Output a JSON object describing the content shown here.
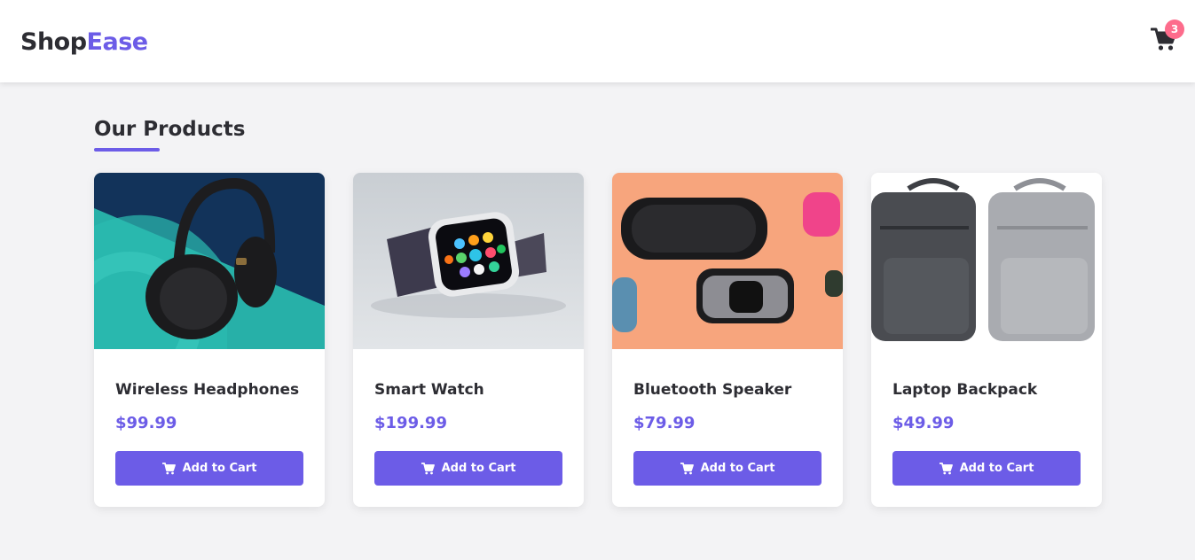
{
  "brand": {
    "part1": "Shop",
    "part2": "Ease"
  },
  "cart": {
    "count": "3",
    "icon": "cart-icon"
  },
  "section": {
    "title": "Our Products"
  },
  "products": [
    {
      "name": "Wireless Headphones",
      "price": "$99.99",
      "button": "Add to Cart",
      "image": "headphones-image"
    },
    {
      "name": "Smart Watch",
      "price": "$199.99",
      "button": "Add to Cart",
      "image": "smartwatch-image"
    },
    {
      "name": "Bluetooth Speaker",
      "price": "$79.99",
      "button": "Add to Cart",
      "image": "speaker-image"
    },
    {
      "name": "Laptop Backpack",
      "price": "$49.99",
      "button": "Add to Cart",
      "image": "backpack-image"
    }
  ],
  "colors": {
    "accent": "#6c5ce7",
    "badge": "#fd6c8c",
    "background": "#f3f3f5",
    "text": "#2d2d33"
  }
}
